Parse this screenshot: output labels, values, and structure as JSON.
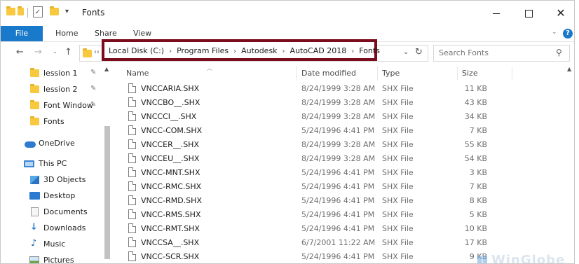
{
  "window": {
    "title": "Fonts"
  },
  "ribbon": {
    "file": "File",
    "home": "Home",
    "share": "Share",
    "view": "View"
  },
  "address": {
    "prefix": "‹‹",
    "crumbs": [
      "Local Disk (C:)",
      "Program Files",
      "Autodesk",
      "AutoCAD 2018",
      "Fonts"
    ]
  },
  "search": {
    "placeholder": "Search Fonts"
  },
  "sidebar": {
    "quick": [
      {
        "label": "lession 1"
      },
      {
        "label": "lession 2"
      },
      {
        "label": "Font Window"
      },
      {
        "label": "Fonts"
      }
    ],
    "onedrive": "OneDrive",
    "thispc": "This PC",
    "pc_items": [
      {
        "label": "3D Objects",
        "icon": "cube-icon"
      },
      {
        "label": "Desktop",
        "icon": "desktop-icon"
      },
      {
        "label": "Documents",
        "icon": "documents-icon"
      },
      {
        "label": "Downloads",
        "icon": "downloads-icon"
      },
      {
        "label": "Music",
        "icon": "music-icon"
      },
      {
        "label": "Pictures",
        "icon": "pictures-icon"
      }
    ]
  },
  "columns": {
    "name": "Name",
    "date": "Date modified",
    "type": "Type",
    "size": "Size"
  },
  "files": [
    {
      "name": "VNCCARIA.SHX",
      "date": "8/24/1999 3:28 AM",
      "type": "SHX File",
      "size": "11 KB"
    },
    {
      "name": "VNCCBO__.SHX",
      "date": "8/24/1999 3:28 AM",
      "type": "SHX File",
      "size": "43 KB"
    },
    {
      "name": "VNCCCI__.SHX",
      "date": "8/24/1999 3:28 AM",
      "type": "SHX File",
      "size": "34 KB"
    },
    {
      "name": "VNCC-COM.SHX",
      "date": "5/24/1996 4:41 PM",
      "type": "SHX File",
      "size": "7 KB"
    },
    {
      "name": "VNCCER__.SHX",
      "date": "8/24/1999 3:28 AM",
      "type": "SHX File",
      "size": "55 KB"
    },
    {
      "name": "VNCCEU__.SHX",
      "date": "8/24/1999 3:28 AM",
      "type": "SHX File",
      "size": "54 KB"
    },
    {
      "name": "VNCC-MNT.SHX",
      "date": "5/24/1996 4:41 PM",
      "type": "SHX File",
      "size": "3 KB"
    },
    {
      "name": "VNCC-RMC.SHX",
      "date": "5/24/1996 4:41 PM",
      "type": "SHX File",
      "size": "7 KB"
    },
    {
      "name": "VNCC-RMD.SHX",
      "date": "5/24/1996 4:41 PM",
      "type": "SHX File",
      "size": "8 KB"
    },
    {
      "name": "VNCC-RMS.SHX",
      "date": "5/24/1996 4:41 PM",
      "type": "SHX File",
      "size": "5 KB"
    },
    {
      "name": "VNCC-RMT.SHX",
      "date": "5/24/1996 4:41 PM",
      "type": "SHX File",
      "size": "10 KB"
    },
    {
      "name": "VNCCSA__.SHX",
      "date": "6/7/2001 11:22 AM",
      "type": "SHX File",
      "size": "17 KB"
    },
    {
      "name": "VNCC-SCR.SHX",
      "date": "5/24/1996 4:41 PM",
      "type": "SHX File",
      "size": "9 KB"
    }
  ],
  "watermark": "WinGlobe",
  "colors": {
    "accent": "#1979ca",
    "highlight": "#7a0c1e",
    "folder": "#f8c93e"
  }
}
